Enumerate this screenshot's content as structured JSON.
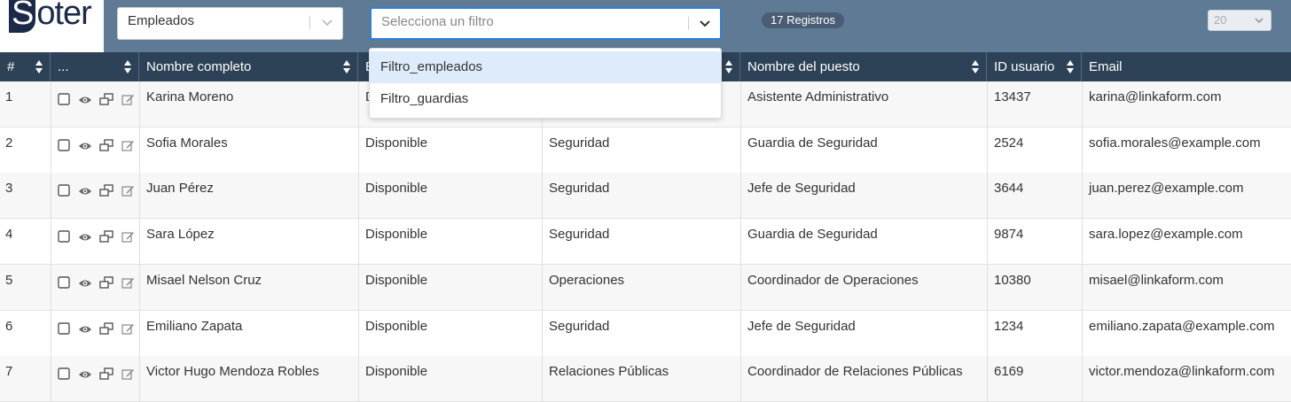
{
  "app": {
    "logo_s": "S",
    "logo_rest": "oter"
  },
  "toolbar": {
    "entity_select": "Empleados",
    "filter_placeholder": "Selecciona un filtro",
    "records_badge": "17 Registros",
    "page_size": "20"
  },
  "filter_dropdown": {
    "options": [
      "Filtro_empleados",
      "Filtro_guardias"
    ],
    "highlighted_index": 0
  },
  "table": {
    "columns": [
      "#",
      "...",
      "Nombre completo",
      "E",
      "",
      "Nombre del puesto",
      "ID usuario",
      "Email"
    ],
    "rows": [
      {
        "n": "1",
        "nombre": "Karina Moreno",
        "estado": "D",
        "area": "",
        "puesto": "Asistente Administrativo",
        "id": "13437",
        "email": "karina@linkaform.com"
      },
      {
        "n": "2",
        "nombre": "Sofia Morales",
        "estado": "Disponible",
        "area": "Seguridad",
        "puesto": "Guardia de Seguridad",
        "id": "2524",
        "email": "sofia.morales@example.com"
      },
      {
        "n": "3",
        "nombre": "Juan Pérez",
        "estado": "Disponible",
        "area": "Seguridad",
        "puesto": "Jefe de Seguridad",
        "id": "3644",
        "email": "juan.perez@example.com"
      },
      {
        "n": "4",
        "nombre": "Sara López",
        "estado": "Disponible",
        "area": "Seguridad",
        "puesto": "Guardia de Seguridad",
        "id": "9874",
        "email": "sara.lopez@example.com"
      },
      {
        "n": "5",
        "nombre": "Misael Nelson Cruz",
        "estado": "Disponible",
        "area": "Operaciones",
        "puesto": "Coordinador de Operaciones",
        "id": "10380",
        "email": "misael@linkaform.com"
      },
      {
        "n": "6",
        "nombre": "Emiliano Zapata",
        "estado": "Disponible",
        "area": "Seguridad",
        "puesto": "Jefe de Seguridad",
        "id": "1234",
        "email": "emiliano.zapata@example.com"
      },
      {
        "n": "7",
        "nombre": "Victor Hugo Mendoza Robles",
        "estado": "Disponible",
        "area": "Relaciones Públicas",
        "puesto": "Coordinador de Relaciones Públicas",
        "id": "6169",
        "email": "victor.mendoza@linkaform.com"
      }
    ]
  },
  "colors": {
    "topbar": "#5e7a95",
    "header": "#2e4257",
    "focus": "#2f7fd8",
    "highlight": "#deebfa"
  },
  "icons": [
    "checkbox-icon",
    "eye-icon",
    "copy-icon",
    "edit-icon",
    "chevron-down-icon",
    "sort-icon"
  ]
}
